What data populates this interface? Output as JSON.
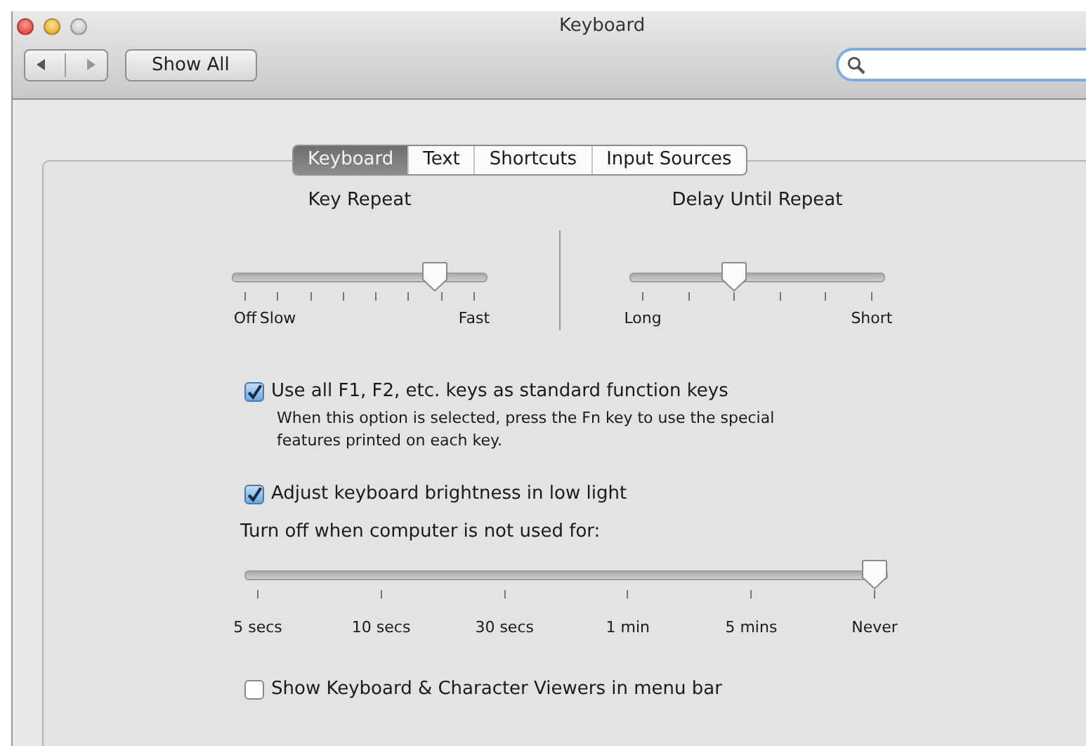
{
  "window": {
    "title": "Keyboard"
  },
  "toolbar": {
    "show_all": "Show All"
  },
  "tabs": [
    {
      "label": "Keyboard",
      "selected": true
    },
    {
      "label": "Text",
      "selected": false
    },
    {
      "label": "Shortcuts",
      "selected": false
    },
    {
      "label": "Input Sources",
      "selected": false
    }
  ],
  "sliders": [
    {
      "title": "Key Repeat",
      "level": 0.83,
      "ticks": [
        {
          "kind": "labeled",
          "label": "Off"
        },
        {
          "kind": "labeled",
          "label": "Slow"
        },
        {
          "kind": "plain"
        },
        {
          "kind": "plain"
        },
        {
          "kind": "plain"
        },
        {
          "kind": "plain"
        },
        {
          "kind": "plain"
        },
        {
          "kind": "labeled",
          "label": "Fast"
        }
      ]
    },
    {
      "title": "Delay Until Repeat",
      "level": 0.4,
      "ticks": [
        {
          "kind": "labeled",
          "label": "Long"
        },
        {
          "kind": "plain"
        },
        {
          "kind": "plain"
        },
        {
          "kind": "plain"
        },
        {
          "kind": "plain"
        },
        {
          "kind": "labeled",
          "label": "Short"
        }
      ]
    }
  ],
  "options": [
    {
      "kind": "checkbox",
      "label": "Use all F1, F2, etc. keys as standard function keys",
      "checked": true,
      "note": "When this option is selected, press the Fn key to use the special features printed on each key."
    },
    {
      "kind": "checkbox",
      "label": "Adjust keyboard brightness in low light",
      "checked": true
    },
    {
      "kind": "caption",
      "label": "Turn off when computer is not used for:"
    },
    {
      "kind": "slider",
      "level": 1,
      "ticks": [
        {
          "kind": "labeled",
          "label": "5 secs"
        },
        {
          "kind": "labeled",
          "label": "10 secs"
        },
        {
          "kind": "labeled",
          "label": "30 secs"
        },
        {
          "kind": "labeled",
          "label": "1 min"
        },
        {
          "kind": "labeled",
          "label": "5 mins"
        },
        {
          "kind": "labeled",
          "label": "Never"
        }
      ]
    },
    {
      "kind": "checkbox",
      "label": "Show Keyboard & Character Viewers in menu bar",
      "checked": false
    }
  ]
}
